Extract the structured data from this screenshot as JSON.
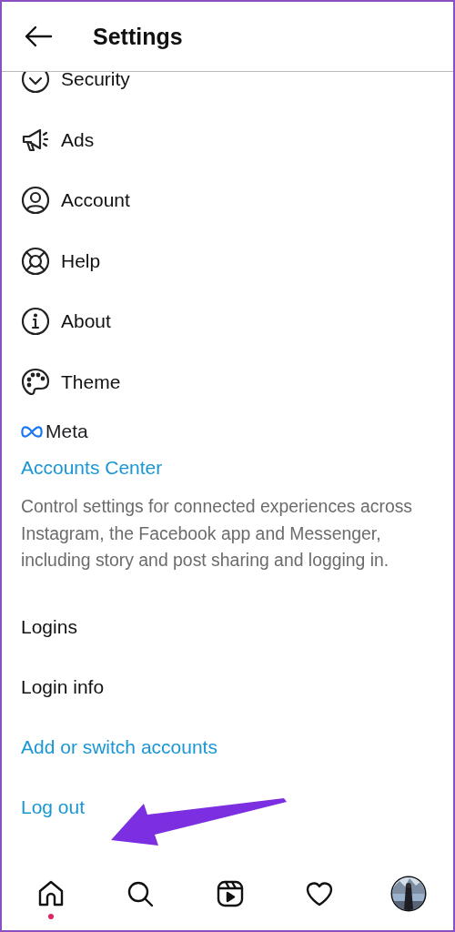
{
  "header": {
    "title": "Settings"
  },
  "menu_items": [
    {
      "label": "Security"
    },
    {
      "label": "Ads"
    },
    {
      "label": "Account"
    },
    {
      "label": "Help"
    },
    {
      "label": "About"
    },
    {
      "label": "Theme"
    }
  ],
  "meta_section": {
    "brand": "Meta",
    "link": "Accounts Center",
    "description": "Control settings for connected experiences across Instagram, the Facebook app and Messenger, including story and post sharing and logging in."
  },
  "logins_section": {
    "heading": "Logins",
    "items": [
      {
        "label": "Login info",
        "kind": "plain"
      },
      {
        "label": "Add or switch accounts",
        "kind": "link"
      },
      {
        "label": "Log out",
        "kind": "link"
      }
    ]
  },
  "bottom_nav": [
    {
      "notification": true
    },
    {
      "notification": false
    },
    {
      "notification": false
    },
    {
      "notification": false
    },
    {
      "notification": false,
      "kind": "picture"
    }
  ]
}
